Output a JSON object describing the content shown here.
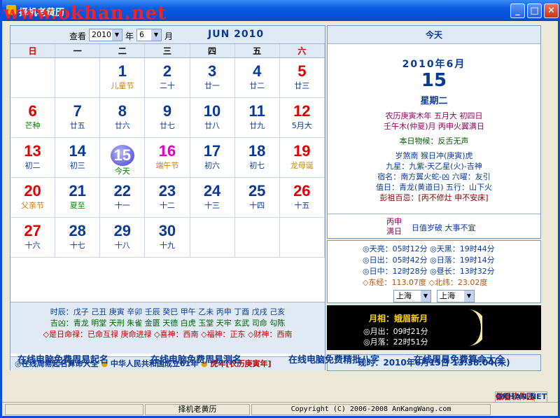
{
  "window": {
    "title": "择机老黄历",
    "watermark": "www.okhan.net"
  },
  "nav": {
    "view_label": "查看",
    "year_value": "2010",
    "year_label": "年",
    "month_value": "6",
    "month_label": "月",
    "month_title": "JUN 2010"
  },
  "weekdays": [
    "日",
    "一",
    "二",
    "三",
    "四",
    "五",
    "六"
  ],
  "weeks": [
    [
      {
        "n": "",
        "s": ""
      },
      {
        "n": "",
        "s": ""
      },
      {
        "n": "1",
        "s": "儿童节"
      },
      {
        "n": "2",
        "s": "二十"
      },
      {
        "n": "3",
        "s": "廿一"
      },
      {
        "n": "4",
        "s": "廿二"
      },
      {
        "n": "5",
        "s": "廿三"
      }
    ],
    [
      {
        "n": "6",
        "s": "芒种"
      },
      {
        "n": "7",
        "s": "廿五"
      },
      {
        "n": "8",
        "s": "廿六"
      },
      {
        "n": "9",
        "s": "廿七"
      },
      {
        "n": "10",
        "s": "廿八"
      },
      {
        "n": "11",
        "s": "廿九"
      },
      {
        "n": "12",
        "s": "5月大"
      }
    ],
    [
      {
        "n": "13",
        "s": "初二"
      },
      {
        "n": "14",
        "s": "初三"
      },
      {
        "n": "15",
        "s": "今天"
      },
      {
        "n": "16",
        "s": "端午节"
      },
      {
        "n": "17",
        "s": "初六"
      },
      {
        "n": "18",
        "s": "初七"
      },
      {
        "n": "19",
        "s": "龙母诞"
      }
    ],
    [
      {
        "n": "20",
        "s": "父亲节"
      },
      {
        "n": "21",
        "s": "夏至"
      },
      {
        "n": "22",
        "s": "十一"
      },
      {
        "n": "23",
        "s": "十二"
      },
      {
        "n": "24",
        "s": "十三"
      },
      {
        "n": "25",
        "s": "十四"
      },
      {
        "n": "26",
        "s": "十五"
      }
    ],
    [
      {
        "n": "27",
        "s": "十六"
      },
      {
        "n": "28",
        "s": "十七"
      },
      {
        "n": "29",
        "s": "十八"
      },
      {
        "n": "30",
        "s": "十九"
      },
      {
        "n": "",
        "s": ""
      },
      {
        "n": "",
        "s": ""
      },
      {
        "n": "",
        "s": ""
      }
    ]
  ],
  "hours": {
    "line1": "时辰：戊子 己丑 庚寅 辛卯 壬辰 癸巳 甲午 乙未 丙申 丁酉 戊戌 己亥",
    "line2": "吉凶：青龙 明堂 天刑 朱雀 金匮 天德 白虎 玉堂 天牢 玄武 司命 勾陈",
    "line3": "◇是日命禄：已命互禄 庚命进禄 ◇喜神：西南 ◇福神：正东 ◇财神：西南"
  },
  "footer": {
    "left": "◎在线周易起名算命大全",
    "mid": "中华人民共和国成立61年",
    "right": "虎年[农历庚寅年]"
  },
  "today": {
    "header": "今天",
    "year_month": "2010年6月",
    "day": "15",
    "weekday": "星期二",
    "lunar1": "农历庚寅木年 五月大 初四日",
    "lunar2": "壬午木(仲夏)月 丙申火翼满日",
    "item": "本日物候：反舌无声",
    "l1": "岁煞南 猴日冲(庚寅)虎",
    "l2": "九星：九紫-天乙星(火)-吉神",
    "l3": "宿名：南方翼火蛇-凶 六曜：友引",
    "l4": "值日：青龙(黄道日) 五行：山下火",
    "l5": "彭祖百忌：[丙不修灶 申不安床]",
    "dayname1": "丙申",
    "dayname2": "满日",
    "daynote": "日值岁破 大事不宜"
  },
  "sun": {
    "r1a": "◎天亮：05时12分",
    "r1b": "◎天黑：19时44分",
    "r2a": "◎日出：05时42分",
    "r2b": "◎日落：19时14分",
    "r3a": "◎日中：12时28分",
    "r3b": "◎昼长：13时32分",
    "r4a": "◇东经：113.07度",
    "r4b": "◇北纬：23.02度",
    "city1": "上海",
    "city2": "上海"
  },
  "moon": {
    "phase_label": "月相：",
    "phase": "娥眉新月",
    "rise": "◎月出：09时21分",
    "set": "◎月落：22时51分"
  },
  "now": "现时：2010年6月15日 13:38:04(未)",
  "links": [
    "在线电脑免费周易起名",
    "在线电脑免费周易测名",
    "在线电脑免费精批八字",
    "在线周易免费算命大全"
  ],
  "status": {
    "app": "择机老黄历",
    "copyright": "Copyright (C) 2006-2008 AnKangWang.com",
    "logo": "傲看软件园",
    "logo2": "OKHAN.NET"
  }
}
